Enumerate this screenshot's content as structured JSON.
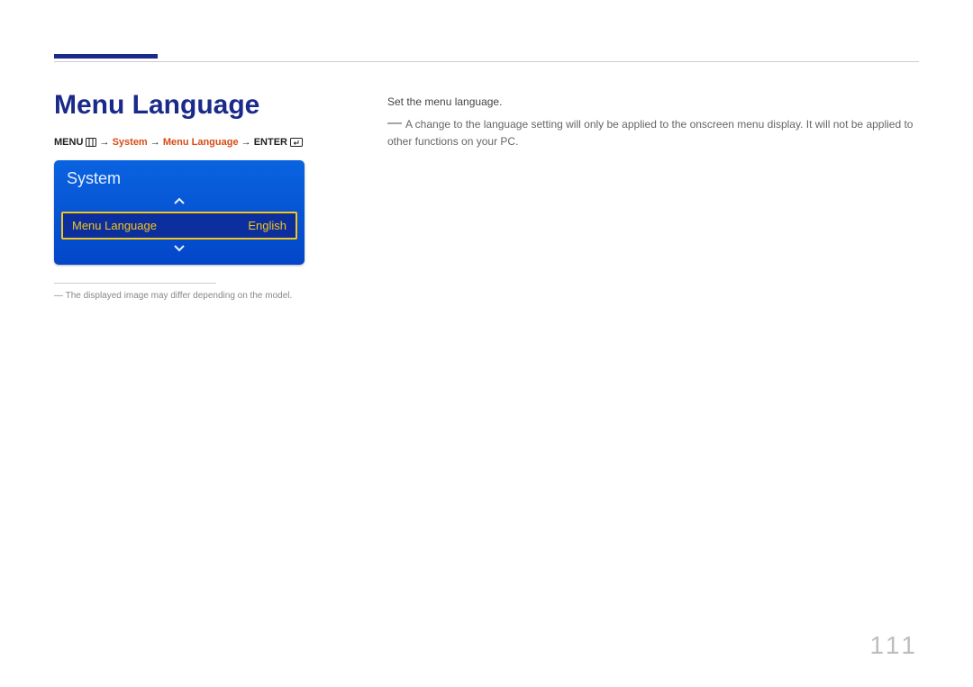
{
  "heading": "Menu Language",
  "breadcrumb": {
    "menu": "MENU",
    "arrow": "→",
    "system": "System",
    "menu_language": "Menu Language",
    "enter": "ENTER"
  },
  "osd": {
    "title": "System",
    "selected_label": "Menu Language",
    "selected_value": "English"
  },
  "caption": "The displayed image may differ depending on the model.",
  "description": "Set the menu language.",
  "note": "A change to the language setting will only be applied to the onscreen menu display. It will not be applied to other functions on your PC.",
  "page_number": "111"
}
